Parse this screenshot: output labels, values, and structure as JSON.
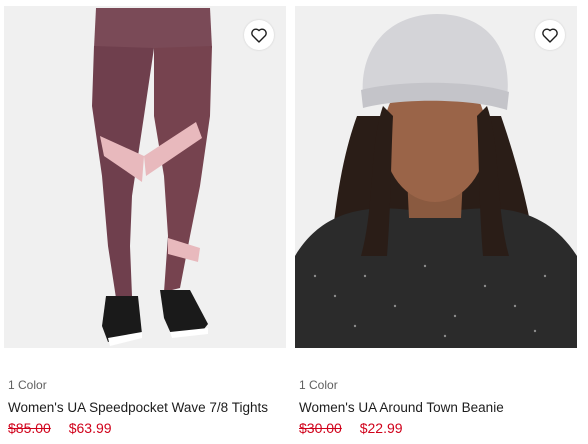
{
  "colors": {
    "sale": "#d0021b",
    "text": "#1d1d1d",
    "muted": "#5f5f5f",
    "image_bg": "#f0f0f0"
  },
  "products": [
    {
      "image_alt": "Women's UA Speedpocket Wave 7/8 Tights",
      "favorite_icon": "heart-outline-icon",
      "color_count": "1 Color",
      "name": "Women's UA Speedpocket Wave 7/8 Tights",
      "original_price": "$85.00",
      "sale_price": "$63.99"
    },
    {
      "image_alt": "Women's UA Around Town Beanie",
      "favorite_icon": "heart-outline-icon",
      "color_count": "1 Color",
      "name": "Women's UA Around Town Beanie",
      "original_price": "$30.00",
      "sale_price": "$22.99"
    }
  ]
}
